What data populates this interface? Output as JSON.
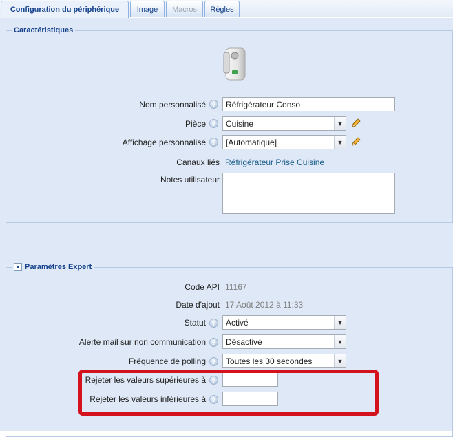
{
  "tabs": [
    {
      "label": "Configuration du périphérique",
      "state": "active"
    },
    {
      "label": "Image",
      "state": "normal"
    },
    {
      "label": "Macros",
      "state": "disabled"
    },
    {
      "label": "Règles",
      "state": "normal"
    }
  ],
  "characteristics": {
    "title": "Caractéristiques",
    "device_icon": "smart-plug-icon",
    "name_label": "Nom personnalisé",
    "name_value": "Réfrigérateur Conso",
    "room_label": "Pièce",
    "room_value": "Cuisine",
    "display_label": "Affichage personnalisé",
    "display_value": "[Automatique]",
    "channels_label": "Canaux liés",
    "channels_value": "Réfrigérateur Prise Cuisine",
    "notes_label": "Notes utilisateur",
    "notes_value": ""
  },
  "expert": {
    "title": "Paramètres Expert",
    "collapse_symbol": "▲",
    "api_label": "Code API",
    "api_value": "11167",
    "date_label": "Date d'ajout",
    "date_value": "17 Août 2012 à 11:33",
    "status_label": "Statut",
    "status_value": "Activé",
    "alert_label": "Alerte mail sur non communication",
    "alert_value": "Désactivé",
    "polling_label": "Fréquence de polling",
    "polling_value": "Toutes les 30 secondes",
    "reject_upper_label": "Rejeter les valeurs supérieures à",
    "reject_upper_value": "",
    "reject_lower_label": "Rejeter les valeurs inférieures à",
    "reject_lower_value": ""
  },
  "colors": {
    "accent": "#15428b",
    "highlight_border": "#d4121d",
    "panel_bg": "#dfe8f6"
  },
  "icons": {
    "help": "help-icon",
    "dropdown": "chevron-down-icon",
    "edit": "pencil-icon"
  }
}
